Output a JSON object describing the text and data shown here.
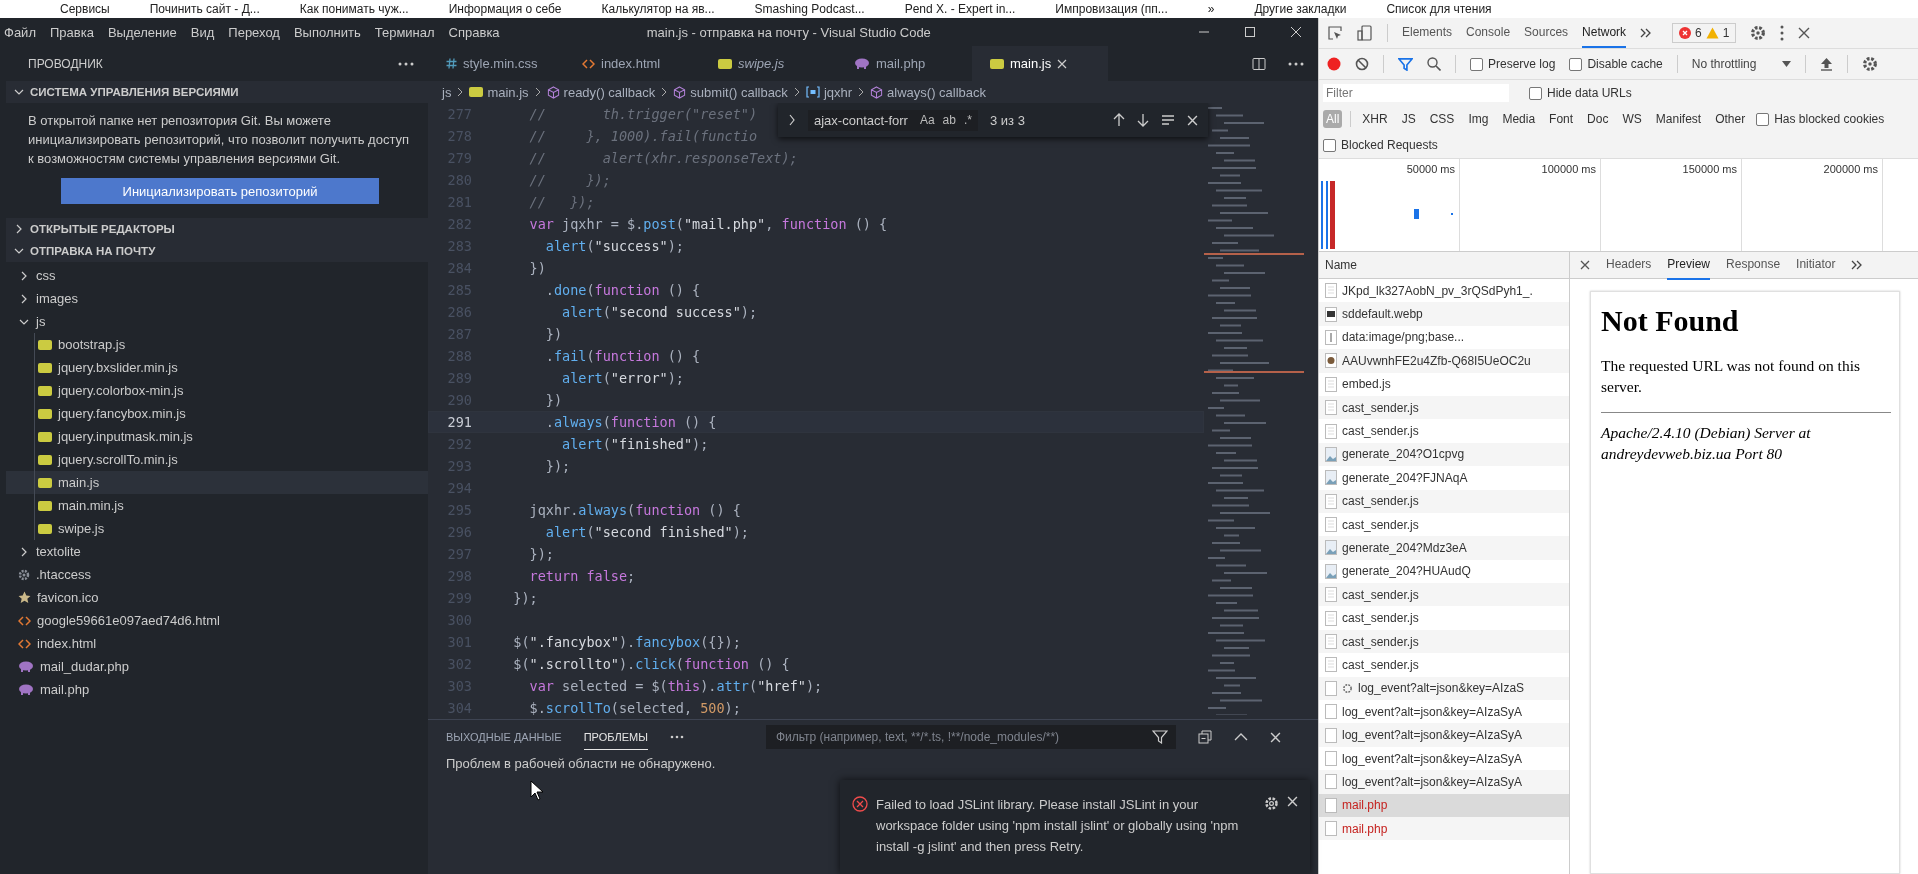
{
  "bookmarks": [
    "Сервисы",
    "Починить сайт - Д...",
    "Как понимать чуж...",
    "Информация о себе",
    "Калькулятор на яв...",
    "Smashing Podcast...",
    "Pend X. - Expert in...",
    "Импровизация (пп...",
    "»",
    "Другие закладки",
    "Список для чтения"
  ],
  "menu": [
    "Файл",
    "Правка",
    "Выделение",
    "Вид",
    "Переход",
    "Выполнить",
    "Терминал",
    "Справка"
  ],
  "window": {
    "title": "main.js - отправка на почту - Visual Studio Code"
  },
  "sidebar": {
    "title": "ПРОВОДНИК",
    "sections": [
      {
        "title": "СИСТЕМА УПРАВЛЕНИЯ ВЕРСИЯМИ",
        "kind": "scm",
        "expanded": true,
        "message": "В открытой папке нет репозитория Git. Вы можете инициализировать репозиторий, что позволит получить доступ к возможностям системы управления версиями Git.",
        "button": "Инициализировать репозиторий"
      },
      {
        "title": "ОТКРЫТЫЕ РЕДАКТОРЫ",
        "expanded": false
      },
      {
        "title": "ОТПРАВКА НА ПОЧТУ",
        "kind": "tree",
        "expanded": true,
        "items": [
          {
            "name": "css",
            "kind": "folder",
            "expanded": false,
            "selected": false
          },
          {
            "name": "images",
            "kind": "folder",
            "expanded": false,
            "selected": false
          },
          {
            "name": "js",
            "kind": "folder",
            "expanded": true,
            "selected": false,
            "children": [
              {
                "name": "bootstrap.js",
                "kind": "js",
                "selected": false
              },
              {
                "name": "jquery.bxslider.min.js",
                "kind": "js",
                "selected": false
              },
              {
                "name": "jquery.colorbox-min.js",
                "kind": "js",
                "selected": false
              },
              {
                "name": "jquery.fancybox.min.js",
                "kind": "js",
                "selected": false
              },
              {
                "name": "jquery.inputmask.min.js",
                "kind": "js",
                "selected": false
              },
              {
                "name": "jquery.scrollTo.min.js",
                "kind": "js",
                "selected": false
              },
              {
                "name": "main.js",
                "kind": "js",
                "selected": true
              },
              {
                "name": "main.min.js",
                "kind": "js",
                "selected": false
              },
              {
                "name": "swipe.js",
                "kind": "js",
                "selected": false
              }
            ]
          },
          {
            "name": "textolite",
            "kind": "folder",
            "expanded": false,
            "selected": false
          },
          {
            "name": ".htaccess",
            "kind": "settings",
            "selected": false
          },
          {
            "name": "favicon.ico",
            "kind": "image",
            "selected": false
          },
          {
            "name": "google59661e097aed74d6.html",
            "kind": "html",
            "selected": false
          },
          {
            "name": "index.html",
            "kind": "html",
            "selected": false
          },
          {
            "name": "mail_dudar.php",
            "kind": "php",
            "selected": false
          },
          {
            "name": "mail.php",
            "kind": "php",
            "selected": false
          }
        ]
      }
    ]
  },
  "editor_tabs": [
    {
      "label": "style.min.css",
      "kind": "css",
      "preview": false,
      "selected": false
    },
    {
      "label": "index.html",
      "kind": "html",
      "preview": false,
      "selected": false
    },
    {
      "label": "swipe.js",
      "kind": "js",
      "preview": true,
      "selected": false
    },
    {
      "label": "mail.php",
      "kind": "php",
      "preview": false,
      "selected": false
    },
    {
      "label": "main.js",
      "kind": "js",
      "preview": false,
      "selected": true
    }
  ],
  "breadcrumbs": [
    {
      "label": "js",
      "kind": "folder"
    },
    {
      "label": "main.js",
      "kind": "js"
    },
    {
      "label": "ready() callback",
      "kind": "method"
    },
    {
      "label": "submit() callback",
      "kind": "method"
    },
    {
      "label": "jqxhr",
      "kind": "variable"
    },
    {
      "label": "always() callback",
      "kind": "method"
    }
  ],
  "editor": {
    "find": {
      "value": "ajax-contact-forr",
      "toggles": [
        "Aa",
        "ab",
        ".*"
      ],
      "count": "3 из 3"
    },
    "lines": [
      {
        "number": "277",
        "current": false,
        "tokens": [
          {
            "kind": "comment",
            "text": "    //       th.trigger(\"reset\")"
          }
        ]
      },
      {
        "number": "278",
        "current": false,
        "tokens": [
          {
            "kind": "comment",
            "text": "    //     }, 1000).fail(functio"
          }
        ]
      },
      {
        "number": "279",
        "current": false,
        "tokens": [
          {
            "kind": "comment",
            "text": "    //       alert(xhr.responseText);"
          }
        ]
      },
      {
        "number": "280",
        "current": false,
        "tokens": [
          {
            "kind": "comment",
            "text": "    //     });"
          }
        ]
      },
      {
        "number": "281",
        "current": false,
        "tokens": [
          {
            "kind": "comment",
            "text": "    //   });"
          }
        ]
      },
      {
        "number": "282",
        "current": false,
        "tokens": [
          {
            "kind": "keyword",
            "text": "    var"
          },
          {
            "kind": "plain",
            "text": " jqxhr = $."
          },
          {
            "kind": "method",
            "text": "post"
          },
          {
            "kind": "plain",
            "text": "("
          },
          {
            "kind": "string",
            "text": "\"mail.php\""
          },
          {
            "kind": "plain",
            "text": ", "
          },
          {
            "kind": "keyword",
            "text": "function"
          },
          {
            "kind": "plain",
            "text": " () {"
          }
        ]
      },
      {
        "number": "283",
        "current": false,
        "tokens": [
          {
            "kind": "method",
            "text": "      alert"
          },
          {
            "kind": "plain",
            "text": "("
          },
          {
            "kind": "string",
            "text": "\"success\""
          },
          {
            "kind": "plain",
            "text": ");"
          }
        ]
      },
      {
        "number": "284",
        "current": false,
        "tokens": [
          {
            "kind": "plain",
            "text": "    })"
          }
        ]
      },
      {
        "number": "285",
        "current": false,
        "tokens": [
          {
            "kind": "plain",
            "text": "      ."
          },
          {
            "kind": "method",
            "text": "done"
          },
          {
            "kind": "plain",
            "text": "("
          },
          {
            "kind": "keyword",
            "text": "function"
          },
          {
            "kind": "plain",
            "text": " () {"
          }
        ]
      },
      {
        "number": "286",
        "current": false,
        "tokens": [
          {
            "kind": "method",
            "text": "        alert"
          },
          {
            "kind": "plain",
            "text": "("
          },
          {
            "kind": "string",
            "text": "\"second success\""
          },
          {
            "kind": "plain",
            "text": ");"
          }
        ]
      },
      {
        "number": "287",
        "current": false,
        "tokens": [
          {
            "kind": "plain",
            "text": "      })"
          }
        ]
      },
      {
        "number": "288",
        "current": false,
        "tokens": [
          {
            "kind": "plain",
            "text": "      ."
          },
          {
            "kind": "method",
            "text": "fail"
          },
          {
            "kind": "plain",
            "text": "("
          },
          {
            "kind": "keyword",
            "text": "function"
          },
          {
            "kind": "plain",
            "text": " () {"
          }
        ]
      },
      {
        "number": "289",
        "current": false,
        "tokens": [
          {
            "kind": "method",
            "text": "        alert"
          },
          {
            "kind": "plain",
            "text": "("
          },
          {
            "kind": "string",
            "text": "\"error\""
          },
          {
            "kind": "plain",
            "text": ");"
          }
        ]
      },
      {
        "number": "290",
        "current": false,
        "tokens": [
          {
            "kind": "plain",
            "text": "      })"
          }
        ]
      },
      {
        "number": "291",
        "current": true,
        "tokens": [
          {
            "kind": "plain",
            "text": "      ."
          },
          {
            "kind": "method",
            "text": "always"
          },
          {
            "kind": "plain",
            "text": "("
          },
          {
            "kind": "keyword",
            "text": "function"
          },
          {
            "kind": "plain",
            "text": " () {"
          }
        ]
      },
      {
        "number": "292",
        "current": false,
        "tokens": [
          {
            "kind": "method",
            "text": "        alert"
          },
          {
            "kind": "plain",
            "text": "("
          },
          {
            "kind": "string",
            "text": "\"finished\""
          },
          {
            "kind": "plain",
            "text": ");"
          }
        ]
      },
      {
        "number": "293",
        "current": false,
        "tokens": [
          {
            "kind": "plain",
            "text": "      });"
          }
        ]
      },
      {
        "number": "294",
        "current": false
      },
      {
        "number": "295",
        "current": false,
        "tokens": [
          {
            "kind": "plain",
            "text": "    jqxhr."
          },
          {
            "kind": "method",
            "text": "always"
          },
          {
            "kind": "plain",
            "text": "("
          },
          {
            "kind": "keyword",
            "text": "function"
          },
          {
            "kind": "plain",
            "text": " () {"
          }
        ]
      },
      {
        "number": "296",
        "current": false,
        "tokens": [
          {
            "kind": "method",
            "text": "      alert"
          },
          {
            "kind": "plain",
            "text": "("
          },
          {
            "kind": "string",
            "text": "\"second finished\""
          },
          {
            "kind": "plain",
            "text": ");"
          }
        ]
      },
      {
        "number": "297",
        "current": false,
        "tokens": [
          {
            "kind": "plain",
            "text": "    });"
          }
        ]
      },
      {
        "number": "298",
        "current": false,
        "tokens": [
          {
            "kind": "keyword",
            "text": "    return"
          },
          {
            "kind": "keyword",
            "text": " false"
          },
          {
            "kind": "plain",
            "text": ";"
          }
        ]
      },
      {
        "number": "299",
        "current": false,
        "tokens": [
          {
            "kind": "plain",
            "text": "  });"
          }
        ]
      },
      {
        "number": "300",
        "current": false
      },
      {
        "number": "301",
        "current": false,
        "tokens": [
          {
            "kind": "plain",
            "text": "  $("
          },
          {
            "kind": "string",
            "text": "\".fancybox\""
          },
          {
            "kind": "plain",
            "text": ")."
          },
          {
            "kind": "method",
            "text": "fancybox"
          },
          {
            "kind": "plain",
            "text": "({});"
          }
        ]
      },
      {
        "number": "302",
        "current": false,
        "tokens": [
          {
            "kind": "plain",
            "text": "  $("
          },
          {
            "kind": "string",
            "text": "\".scrollto\""
          },
          {
            "kind": "plain",
            "text": ")."
          },
          {
            "kind": "method",
            "text": "click"
          },
          {
            "kind": "plain",
            "text": "("
          },
          {
            "kind": "keyword",
            "text": "function"
          },
          {
            "kind": "plain",
            "text": " () {"
          }
        ]
      },
      {
        "number": "303",
        "current": false,
        "tokens": [
          {
            "kind": "keyword",
            "text": "    var"
          },
          {
            "kind": "plain",
            "text": " selected = $("
          },
          {
            "kind": "keyword",
            "text": "this"
          },
          {
            "kind": "plain",
            "text": ")."
          },
          {
            "kind": "method",
            "text": "attr"
          },
          {
            "kind": "plain",
            "text": "("
          },
          {
            "kind": "string",
            "text": "\"href\""
          },
          {
            "kind": "plain",
            "text": ");"
          }
        ]
      },
      {
        "number": "304",
        "current": false,
        "tokens": [
          {
            "kind": "plain",
            "text": "    $."
          },
          {
            "kind": "method",
            "text": "scrollTo"
          },
          {
            "kind": "plain",
            "text": "(selected, "
          },
          {
            "kind": "number",
            "text": "500"
          },
          {
            "kind": "plain",
            "text": ");"
          }
        ]
      }
    ]
  },
  "panel": {
    "tabs": [
      {
        "label": "ВЫХОДНЫЕ ДАННЫЕ",
        "selected": false
      },
      {
        "label": "ПРОБЛЕМЫ",
        "selected": true
      }
    ],
    "filter": {
      "placeholder": "Фильтр (например, text, **/*.ts, !**/node_modules/**)"
    },
    "message": "Проблем в рабочей области не обнаружено."
  },
  "notification": {
    "message": "Failed to load JSLint library. Please install JSLint in your workspace folder using 'npm install jslint' or globally using 'npm install -g jslint' and then press Retry."
  },
  "devtools": {
    "tabs": [
      {
        "label": "Elements",
        "selected": false
      },
      {
        "label": "Console",
        "selected": false
      },
      {
        "label": "Sources",
        "selected": false
      },
      {
        "label": "Network",
        "selected": true
      }
    ],
    "errors": "6",
    "warnings": "1",
    "toolbar_options": [
      {
        "label": "Preserve log",
        "checked": false
      },
      {
        "label": "Disable cache",
        "checked": false
      }
    ],
    "throttling": "No throttling",
    "filter": {
      "placeholder": "Filter"
    },
    "hide_data_urls": {
      "label": "Hide data URLs",
      "checked": false
    },
    "types": [
      {
        "label": "All",
        "selected": true
      },
      {
        "label": "XHR",
        "selected": false
      },
      {
        "label": "JS",
        "selected": false
      },
      {
        "label": "CSS",
        "selected": false
      },
      {
        "label": "Img",
        "selected": false
      },
      {
        "label": "Media",
        "selected": false
      },
      {
        "label": "Font",
        "selected": false
      },
      {
        "label": "Doc",
        "selected": false
      },
      {
        "label": "WS",
        "selected": false
      },
      {
        "label": "Manifest",
        "selected": false
      },
      {
        "label": "Other",
        "selected": false
      }
    ],
    "has_blocked_cookies": {
      "label": "Has blocked cookies",
      "checked": false
    },
    "blocked_requests": {
      "label": "Blocked Requests",
      "checked": false
    },
    "timeline": {
      "ticks": [
        "50000 ms",
        "100000 ms",
        "150000 ms",
        "200000 ms"
      ]
    },
    "requests": {
      "header": "Name",
      "rows": [
        {
          "name": "JKpd_lk327AobN_pv_3rQSdPyh1_.",
          "kind": "doc",
          "error": false,
          "selected": false
        },
        {
          "name": "sddefault.webp",
          "kind": "media",
          "error": false,
          "selected": false
        },
        {
          "name": "data:image/png;base...",
          "kind": "blank",
          "error": false,
          "selected": false
        },
        {
          "name": "AAUvwnhFE2u4Zfb-Q68I5UeOC2u",
          "kind": "favicon",
          "error": false,
          "selected": false
        },
        {
          "name": "embed.js",
          "kind": "doc",
          "error": false,
          "selected": false
        },
        {
          "name": "cast_sender.js",
          "kind": "doc",
          "error": false,
          "selected": false
        },
        {
          "name": "cast_sender.js",
          "kind": "doc",
          "error": false,
          "selected": false
        },
        {
          "name": "generate_204?O1cpvg",
          "kind": "image",
          "error": false,
          "selected": false
        },
        {
          "name": "generate_204?FJNAqA",
          "kind": "image",
          "error": false,
          "selected": false
        },
        {
          "name": "cast_sender.js",
          "kind": "doc",
          "error": false,
          "selected": false
        },
        {
          "name": "cast_sender.js",
          "kind": "doc",
          "error": false,
          "selected": false
        },
        {
          "name": "generate_204?Mdz3eA",
          "kind": "image",
          "error": false,
          "selected": false
        },
        {
          "name": "generate_204?HUAudQ",
          "kind": "image",
          "error": false,
          "selected": false
        },
        {
          "name": "cast_sender.js",
          "kind": "doc",
          "error": false,
          "selected": false
        },
        {
          "name": "cast_sender.js",
          "kind": "doc",
          "error": false,
          "selected": false
        },
        {
          "name": "cast_sender.js",
          "kind": "doc",
          "error": false,
          "selected": false
        },
        {
          "name": "cast_sender.js",
          "kind": "doc",
          "error": false,
          "selected": false
        },
        {
          "name": "log_event?alt=json&key=AIzaS",
          "kind": "worker",
          "error": false,
          "selected": false
        },
        {
          "name": "log_event?alt=json&key=AIzaSyA",
          "kind": "plain",
          "error": false,
          "selected": false
        },
        {
          "name": "log_event?alt=json&key=AIzaSyA",
          "kind": "plain",
          "error": false,
          "selected": false
        },
        {
          "name": "log_event?alt=json&key=AIzaSyA",
          "kind": "plain",
          "error": false,
          "selected": false
        },
        {
          "name": "log_event?alt=json&key=AIzaSyA",
          "kind": "plain",
          "error": false,
          "selected": false
        },
        {
          "name": "mail.php",
          "kind": "plain",
          "error": true,
          "selected": true
        },
        {
          "name": "mail.php",
          "kind": "plain",
          "error": true,
          "selected": false
        }
      ]
    },
    "detail": {
      "tabs": [
        {
          "label": "Headers",
          "selected": false
        },
        {
          "label": "Preview",
          "selected": true
        },
        {
          "label": "Response",
          "selected": false
        },
        {
          "label": "Initiator",
          "selected": false
        }
      ],
      "preview": {
        "heading": "Not Found",
        "text": "The requested URL was not found on this server.",
        "address": "Apache/2.4.10 (Debian) Server at andreydevweb.biz.ua Port 80"
      }
    }
  }
}
